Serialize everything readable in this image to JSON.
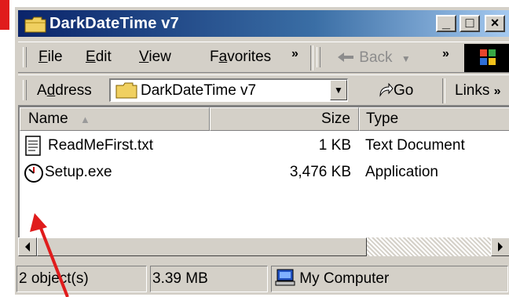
{
  "window": {
    "title": "DarkDateTime v7",
    "controls": [
      "_",
      "□",
      "×"
    ]
  },
  "menu": {
    "items": [
      {
        "label": "File",
        "accel": "F",
        "rest": "ile"
      },
      {
        "label": "Edit",
        "accel": "E",
        "rest": "dit"
      },
      {
        "label": "View",
        "accel": "V",
        "rest": "iew"
      },
      {
        "label": "Favorites",
        "pre": "F",
        "accel": "a",
        "rest": "vorites"
      }
    ],
    "overflow": "»"
  },
  "toolbar": {
    "back_label": "Back",
    "overflow": "»",
    "icons": [
      "back-arrow-icon",
      "windows-logo-icon"
    ]
  },
  "address": {
    "label": "Address",
    "label_pre": "A",
    "label_accel": "d",
    "label_rest": "dress",
    "value": "DarkDateTime v7",
    "go_label": "Go",
    "links_label": "Links",
    "links_overflow": "»"
  },
  "list": {
    "columns": [
      {
        "label": "Name",
        "sort": "ascending"
      },
      {
        "label": "Size"
      },
      {
        "label": "Type"
      }
    ],
    "rows": [
      {
        "name": "ReadMeFirst.txt",
        "size": "1 KB",
        "type": "Text Document",
        "icon": "text-document-icon"
      },
      {
        "name": "Setup.exe",
        "size": "3,476 KB",
        "type": "Application",
        "icon": "setup-clock-icon"
      }
    ]
  },
  "status": {
    "objects": "2 object(s)",
    "size": "3.39 MB",
    "location": "My Computer"
  },
  "annotation": {
    "color": "#e01c1c",
    "icon": "red-arrow-pointer"
  }
}
